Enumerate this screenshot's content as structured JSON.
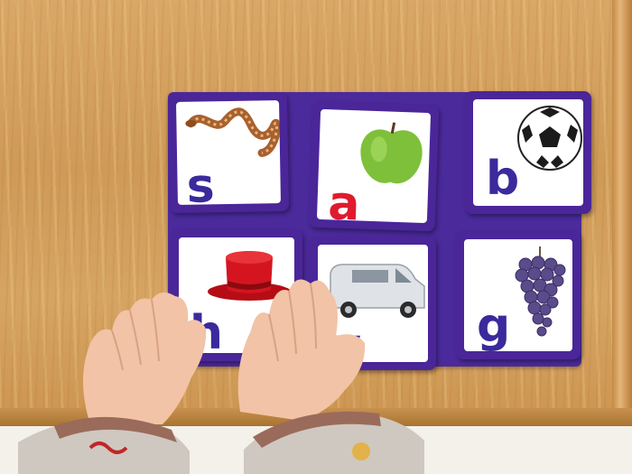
{
  "cards": [
    {
      "letter": "s",
      "letter_color": "#3a2a9c",
      "picture": "snake"
    },
    {
      "letter": "a",
      "letter_color": "#e01a2e",
      "picture": "apple"
    },
    {
      "letter": "b",
      "letter_color": "#3a2a9c",
      "picture": "soccer-ball"
    },
    {
      "letter": "h",
      "letter_color": "#3a2a9c",
      "picture": "top-hat"
    },
    {
      "letter": "v",
      "letter_color": "#3a2a9c",
      "picture": "van"
    },
    {
      "letter": "g",
      "letter_color": "#3a2a9c",
      "picture": "grapes"
    }
  ],
  "colors": {
    "card_border": "#4a2699",
    "wood": "#d6a462",
    "vowel": "#e01a2e",
    "consonant": "#3a2a9c"
  }
}
